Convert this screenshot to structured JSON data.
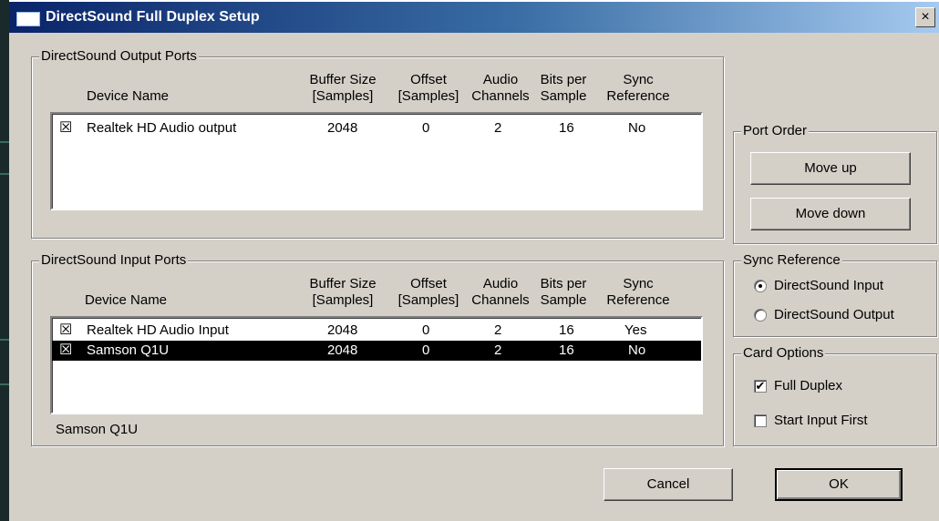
{
  "window": {
    "title": "DirectSound Full Duplex Setup",
    "close_glyph": "×"
  },
  "columns": {
    "device_name": "Device Name",
    "buffer_size": [
      "Buffer Size",
      "[Samples]"
    ],
    "offset": [
      "Offset",
      "[Samples]"
    ],
    "audio_channels": [
      "Audio",
      "Channels"
    ],
    "bits_per_sample": [
      "Bits per",
      "Sample"
    ],
    "sync_reference": [
      "Sync",
      "Reference"
    ]
  },
  "output_ports": {
    "legend": "DirectSound Output Ports",
    "rows": [
      {
        "checked": "☒",
        "name": "Realtek HD Audio output",
        "buffer": "2048",
        "offset": "0",
        "channels": "2",
        "bits": "16",
        "sync": "No",
        "selected": false
      }
    ]
  },
  "input_ports": {
    "legend": "DirectSound Input Ports",
    "rows": [
      {
        "checked": "☒",
        "name": "Realtek HD Audio Input",
        "buffer": "2048",
        "offset": "0",
        "channels": "2",
        "bits": "16",
        "sync": "Yes",
        "selected": false
      },
      {
        "checked": "☒",
        "name": "Samson Q1U",
        "buffer": "2048",
        "offset": "0",
        "channels": "2",
        "bits": "16",
        "sync": "No",
        "selected": true
      }
    ],
    "status": "Samson Q1U"
  },
  "port_order": {
    "legend": "Port Order",
    "move_up": "Move up",
    "move_down": "Move down"
  },
  "sync_reference": {
    "legend": "Sync Reference",
    "options": [
      {
        "label": "DirectSound Input",
        "selected": true
      },
      {
        "label": "DirectSound Output",
        "selected": false
      }
    ]
  },
  "card_options": {
    "legend": "Card Options",
    "full_duplex": {
      "label": "Full Duplex",
      "checked": true,
      "mark": "✔"
    },
    "start_input_first": {
      "label": "Start Input First",
      "checked": false,
      "mark": ""
    }
  },
  "buttons": {
    "cancel": "Cancel",
    "ok": "OK"
  },
  "colors": {
    "title_gradient_start": "#0a246a",
    "title_gradient_end": "#a6caf0",
    "dialog_face": "#d4d0c8",
    "selection_bg": "#000000",
    "selection_fg": "#ffffff"
  }
}
